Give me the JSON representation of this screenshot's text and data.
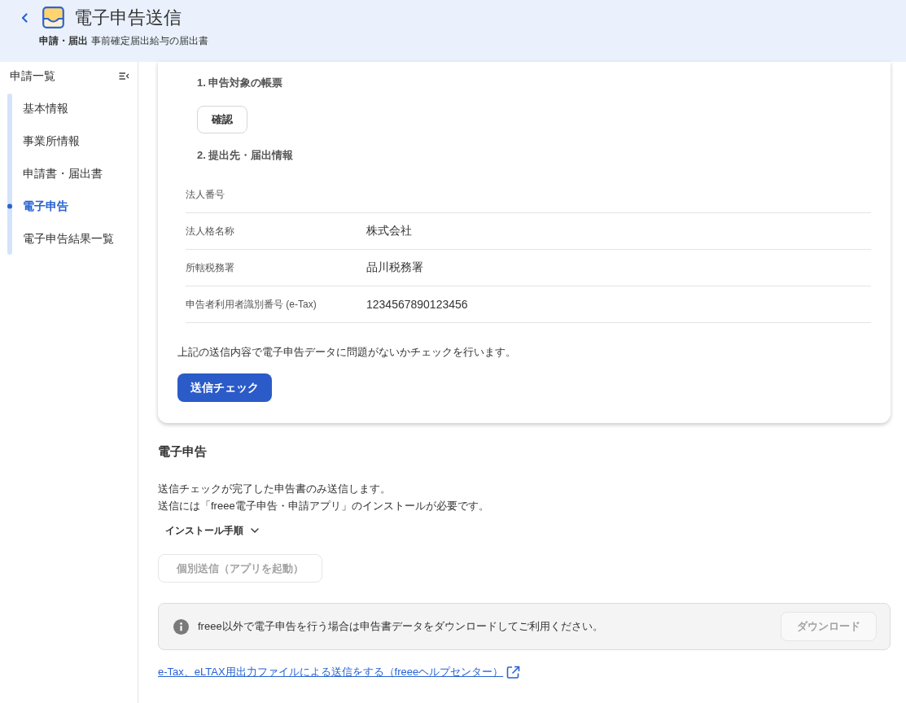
{
  "header": {
    "title": "電子申告送信",
    "category": "申請・届出",
    "document": "事前確定届出給与の届出書"
  },
  "sidebar": {
    "title": "申請一覧",
    "items": [
      {
        "label": "基本情報",
        "selected": false
      },
      {
        "label": "事業所情報",
        "selected": false
      },
      {
        "label": "申請書・届出書",
        "selected": false
      },
      {
        "label": "電子申告",
        "selected": true
      },
      {
        "label": "電子申告結果一覧",
        "selected": false
      }
    ]
  },
  "form_card": {
    "section_1": {
      "heading": "1. 申告対象の帳票",
      "button": "確認"
    },
    "section_2": {
      "heading": "2. 提出先・届出情報",
      "rows": [
        {
          "label": "法人番号"
        },
        {
          "label": "法人格名称",
          "value": "株式会社"
        },
        {
          "label": "所轄税務署",
          "value": "品川税務署"
        },
        {
          "label": "申告者利用者識別番号 (e-Tax)",
          "value": "1234567890123456"
        }
      ]
    },
    "note": "上記の送信内容で電子申告データに問題がないかチェックを行います。",
    "check_button": "送信チェック"
  },
  "e_filing": {
    "heading": "電子申告",
    "description_lines": [
      "送信チェックが完了した申告書のみ送信します。",
      "送信には「freee電子申告・申請アプリ」のインストールが必要です。"
    ],
    "install_steps": {
      "label": "インストール手順",
      "expanded": false
    },
    "send_button": {
      "label": "個別送信（アプリを起動）",
      "disabled": true
    }
  },
  "notice": {
    "text": "freee以外で電子申告を行う場合は申告書データをダウンロードしてご利用ください。",
    "download_button": {
      "label": "ダウンロード",
      "disabled": true
    }
  },
  "help_link": "e-Tax、eLTAX用出力ファイルによる送信をする（freeeヘルプセンター）"
}
